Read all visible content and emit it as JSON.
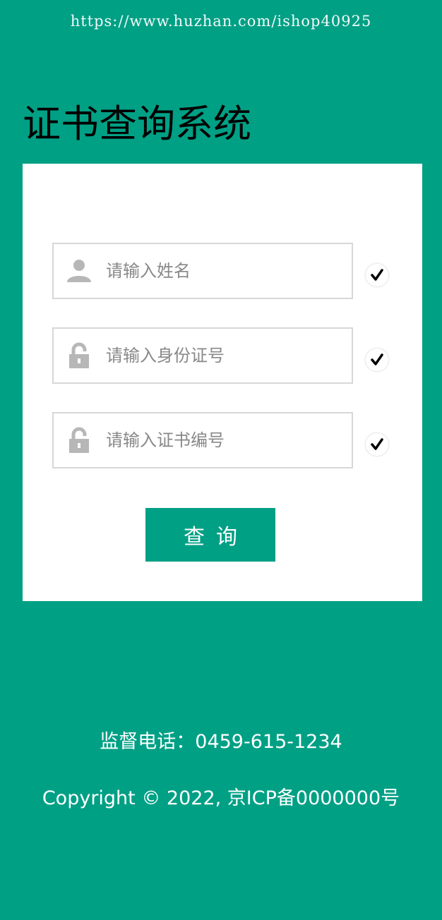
{
  "watermark": "https://www.huzhan.com/ishop40925",
  "header": {
    "title": "证书查询系统"
  },
  "form": {
    "fields": [
      {
        "placeholder": "请输入姓名",
        "icon": "user-icon"
      },
      {
        "placeholder": "请输入身份证号",
        "icon": "lock-icon"
      },
      {
        "placeholder": "请输入证书编号",
        "icon": "lock-icon"
      }
    ],
    "submit_label": "查询"
  },
  "footer": {
    "phone": "监督电话：0459-615-1234",
    "copyright": "Copyright © 2022, 京ICP备0000000号"
  },
  "colors": {
    "background": "#00a085",
    "card": "#ffffff",
    "button": "#00a085",
    "icon": "#b7b7b7"
  }
}
